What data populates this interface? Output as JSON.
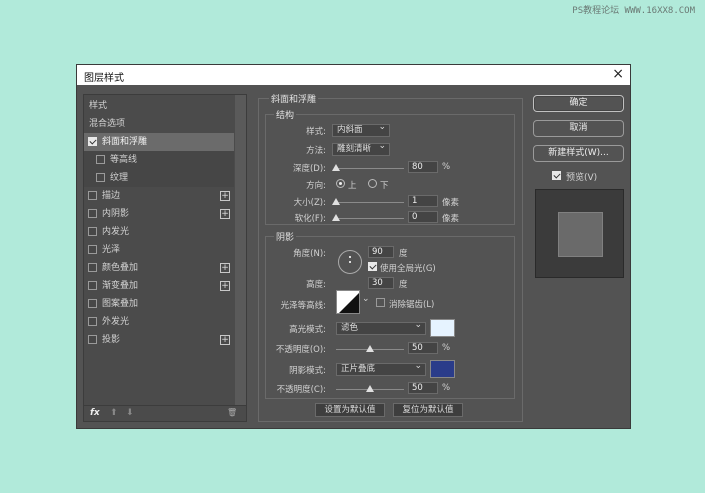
{
  "watermark": "PS教程论坛 WWW.16XX8.COM",
  "window": {
    "title": "图层样式",
    "close": "×"
  },
  "left_list": [
    {
      "label": "样式",
      "kind": "header"
    },
    {
      "label": "混合选项",
      "kind": "header"
    },
    {
      "label": "斜面和浮雕",
      "kind": "check",
      "checked": true,
      "selected": true
    },
    {
      "label": "等高线",
      "kind": "subcheck",
      "checked": false
    },
    {
      "label": "纹理",
      "kind": "subcheck",
      "checked": false
    },
    {
      "label": "描边",
      "kind": "check",
      "checked": false,
      "plus": true
    },
    {
      "label": "内阴影",
      "kind": "check",
      "checked": false,
      "plus": true
    },
    {
      "label": "内发光",
      "kind": "check",
      "checked": false
    },
    {
      "label": "光泽",
      "kind": "check",
      "checked": false
    },
    {
      "label": "颜色叠加",
      "kind": "check",
      "checked": false,
      "plus": true
    },
    {
      "label": "渐变叠加",
      "kind": "check",
      "checked": false,
      "plus": true
    },
    {
      "label": "图案叠加",
      "kind": "check",
      "checked": false
    },
    {
      "label": "外发光",
      "kind": "check",
      "checked": false
    },
    {
      "label": "投影",
      "kind": "check",
      "checked": false,
      "plus": true
    }
  ],
  "footer": {
    "fx": "fx",
    "up": "⬆",
    "down": "⬇",
    "trash": "🗑"
  },
  "bevel": {
    "title": "斜面和浮雕",
    "structure": {
      "title": "结构",
      "style_label": "样式:",
      "style_value": "内斜面",
      "technique_label": "方法:",
      "technique_value": "雕刻清晰",
      "depth_label": "深度(D):",
      "depth_value": "80",
      "depth_unit": "%",
      "depth_pos": 0.0,
      "direction_label": "方向:",
      "dir_up": "上",
      "dir_down": "下",
      "size_label": "大小(Z):",
      "size_value": "1",
      "size_unit": "像素",
      "size_pos": 0.0,
      "soften_label": "软化(F):",
      "soften_value": "0",
      "soften_unit": "像素",
      "soften_pos": 0.0
    },
    "shading": {
      "title": "阴影",
      "angle_label": "角度(N):",
      "angle_value": "90",
      "angle_unit": "度",
      "global_light": "使用全局光(G)",
      "altitude_label": "高度:",
      "altitude_value": "30",
      "altitude_unit": "度",
      "gloss_label": "光泽等高线:",
      "antialias": "消除锯齿(L)",
      "highlight_label": "高光模式:",
      "highlight_value": "滤色",
      "highlight_color": "#e6f3ff",
      "hopacity_label": "不透明度(O):",
      "hopacity_value": "50",
      "hopacity_unit": "%",
      "hopacity_pos": 0.5,
      "shadow_label": "阴影模式:",
      "shadow_value": "正片叠底",
      "shadow_color": "#2a3c8a",
      "sopacity_label": "不透明度(C):",
      "sopacity_value": "50",
      "sopacity_unit": "%",
      "sopacity_pos": 0.5
    },
    "make_default": "设置为默认值",
    "reset_default": "复位为默认值"
  },
  "buttons": {
    "ok": "确定",
    "cancel": "取消",
    "new_style": "新建样式(W)...",
    "preview": "预览(V)"
  }
}
